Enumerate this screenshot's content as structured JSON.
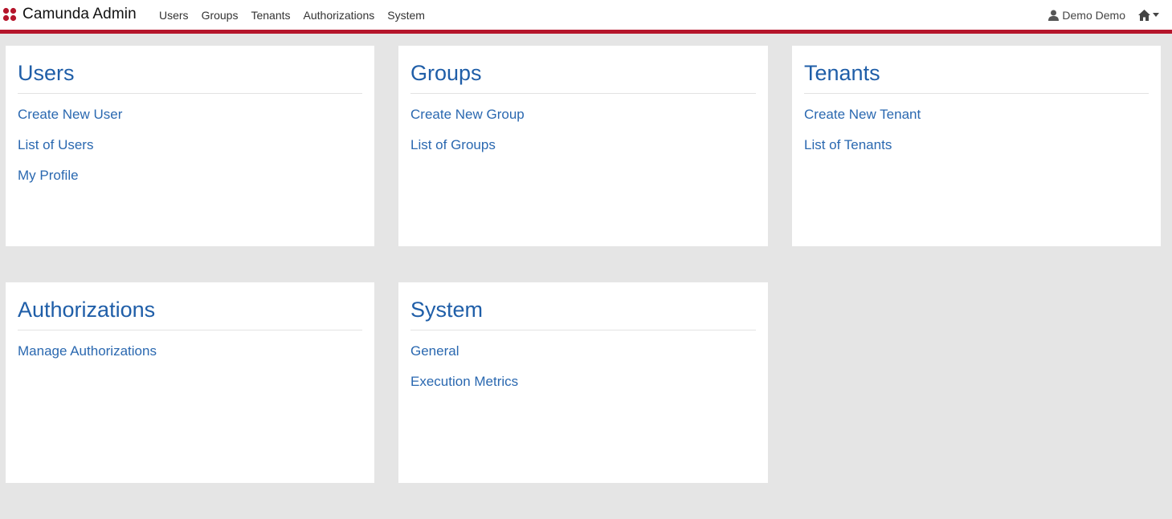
{
  "app": {
    "title": "Camunda Admin",
    "brand_color": "#b5152b",
    "link_color": "#2a68b0"
  },
  "nav": {
    "items": [
      "Users",
      "Groups",
      "Tenants",
      "Authorizations",
      "System"
    ],
    "user_label": "Demo Demo",
    "user_icon": "user-icon",
    "home_icon": "home-icon",
    "caret_icon": "caret-down-icon"
  },
  "panels": {
    "users": {
      "title": "Users",
      "links": [
        "Create New User",
        "List of Users",
        "My Profile"
      ]
    },
    "groups": {
      "title": "Groups",
      "links": [
        "Create New Group",
        "List of Groups"
      ]
    },
    "tenants": {
      "title": "Tenants",
      "links": [
        "Create New Tenant",
        "List of Tenants"
      ]
    },
    "authorizations": {
      "title": "Authorizations",
      "links": [
        "Manage Authorizations"
      ]
    },
    "system": {
      "title": "System",
      "links": [
        "General",
        "Execution Metrics"
      ]
    }
  }
}
